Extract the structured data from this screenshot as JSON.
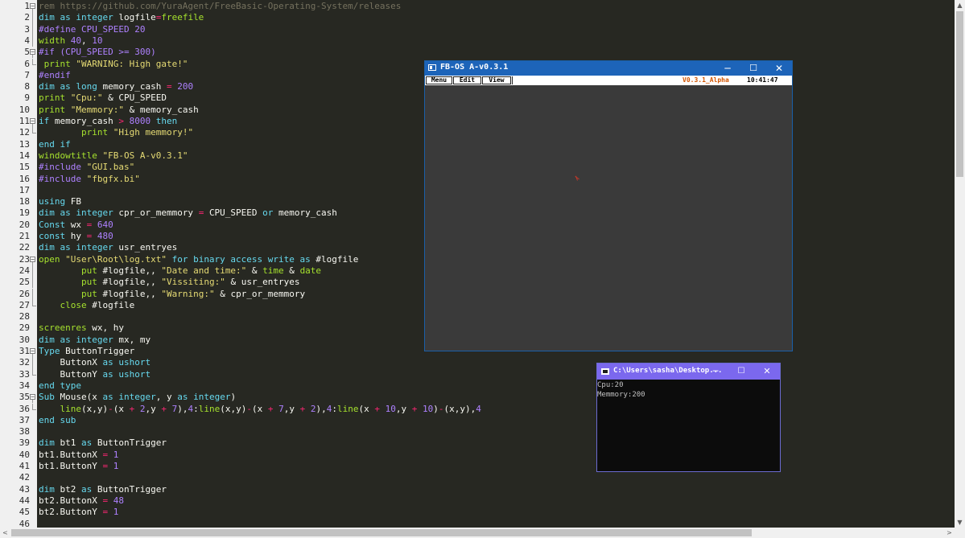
{
  "editor": {
    "lines": [
      {
        "n": "1",
        "fold": "box",
        "segs": [
          [
            "c",
            "rem https://github.com/YuraAgent/FreeBasic-Operating-System/releases"
          ]
        ]
      },
      {
        "n": "2",
        "segs": [
          [
            "k",
            "dim as integer "
          ],
          [
            "",
            "logfile"
          ],
          [
            "o",
            "="
          ],
          [
            "p",
            "freefile"
          ]
        ]
      },
      {
        "n": "3",
        "segs": [
          [
            "d",
            "#define CPU_SPEED 20"
          ]
        ]
      },
      {
        "n": "4",
        "segs": [
          [
            "p",
            "width "
          ],
          [
            "n",
            "40"
          ],
          [
            "",
            ", "
          ],
          [
            "n",
            "10"
          ]
        ]
      },
      {
        "n": "5",
        "fold": "box",
        "segs": [
          [
            "d",
            "#if (CPU_SPEED >= 300)"
          ]
        ]
      },
      {
        "n": "6",
        "fold": "end",
        "segs": [
          [
            "p",
            " print "
          ],
          [
            "s",
            "\"WARNING: High gate!\""
          ]
        ]
      },
      {
        "n": "7",
        "segs": [
          [
            "d",
            "#endif"
          ]
        ]
      },
      {
        "n": "8",
        "segs": [
          [
            "k",
            "dim as long "
          ],
          [
            "",
            "memory_cash "
          ],
          [
            "o",
            "= "
          ],
          [
            "n",
            "200"
          ]
        ]
      },
      {
        "n": "9",
        "segs": [
          [
            "p",
            "print "
          ],
          [
            "s",
            "\"Cpu:\""
          ],
          [
            "",
            " & CPU_SPEED"
          ]
        ]
      },
      {
        "n": "10",
        "segs": [
          [
            "p",
            "print "
          ],
          [
            "s",
            "\"Memmory:\""
          ],
          [
            "",
            " & memory_cash"
          ]
        ]
      },
      {
        "n": "11",
        "fold": "box",
        "segs": [
          [
            "k",
            "if "
          ],
          [
            "",
            "memory_cash "
          ],
          [
            "o",
            "> "
          ],
          [
            "n",
            "8000 "
          ],
          [
            "k",
            "then"
          ]
        ]
      },
      {
        "n": "12",
        "fold": "end",
        "segs": [
          [
            "",
            "        "
          ],
          [
            "p",
            "print "
          ],
          [
            "s",
            "\"High memmory!\""
          ]
        ]
      },
      {
        "n": "13",
        "segs": [
          [
            "k",
            "end if"
          ]
        ]
      },
      {
        "n": "14",
        "segs": [
          [
            "p",
            "windowtitle "
          ],
          [
            "s",
            "\"FB-OS A-v0.3.1\""
          ]
        ]
      },
      {
        "n": "15",
        "segs": [
          [
            "d",
            "#include "
          ],
          [
            "s",
            "\"GUI.bas\""
          ]
        ]
      },
      {
        "n": "16",
        "segs": [
          [
            "d",
            "#include "
          ],
          [
            "s",
            "\"fbgfx.bi\""
          ]
        ]
      },
      {
        "n": "17",
        "segs": []
      },
      {
        "n": "18",
        "segs": [
          [
            "k",
            "using "
          ],
          [
            "",
            "FB"
          ]
        ]
      },
      {
        "n": "19",
        "segs": [
          [
            "k",
            "dim as integer "
          ],
          [
            "",
            "cpr_or_memmory "
          ],
          [
            "o",
            "= "
          ],
          [
            "",
            "CPU_SPEED "
          ],
          [
            "k",
            "or "
          ],
          [
            "",
            "memory_cash"
          ]
        ]
      },
      {
        "n": "20",
        "segs": [
          [
            "k",
            "Const "
          ],
          [
            "",
            "wx "
          ],
          [
            "o",
            "= "
          ],
          [
            "n",
            "640"
          ]
        ]
      },
      {
        "n": "21",
        "segs": [
          [
            "k",
            "const "
          ],
          [
            "",
            "hy "
          ],
          [
            "o",
            "= "
          ],
          [
            "n",
            "480"
          ]
        ]
      },
      {
        "n": "22",
        "segs": [
          [
            "k",
            "dim as integer "
          ],
          [
            "",
            "usr_entryes"
          ]
        ]
      },
      {
        "n": "23",
        "fold": "box",
        "segs": [
          [
            "p",
            "open "
          ],
          [
            "s",
            "\"User\\Root\\log.txt\" "
          ],
          [
            "k",
            "for binary access write as "
          ],
          [
            "",
            "#logfile"
          ]
        ]
      },
      {
        "n": "24",
        "segs": [
          [
            "",
            "        "
          ],
          [
            "p",
            "put "
          ],
          [
            "",
            "#logfile,, "
          ],
          [
            "s",
            "\"Date and time:\""
          ],
          [
            "",
            " & "
          ],
          [
            "p",
            "time"
          ],
          [
            "",
            " & "
          ],
          [
            "p",
            "date"
          ]
        ]
      },
      {
        "n": "25",
        "segs": [
          [
            "",
            "        "
          ],
          [
            "p",
            "put "
          ],
          [
            "",
            "#logfile,, "
          ],
          [
            "s",
            "\"Vissiting:\""
          ],
          [
            "",
            " & usr_entryes"
          ]
        ]
      },
      {
        "n": "26",
        "segs": [
          [
            "",
            "        "
          ],
          [
            "p",
            "put "
          ],
          [
            "",
            "#logfile,, "
          ],
          [
            "s",
            "\"Warning:\""
          ],
          [
            "",
            " & cpr_or_memmory"
          ]
        ]
      },
      {
        "n": "27",
        "fold": "end",
        "segs": [
          [
            "",
            "    "
          ],
          [
            "p",
            "close "
          ],
          [
            "",
            "#logfile"
          ]
        ]
      },
      {
        "n": "28",
        "segs": []
      },
      {
        "n": "29",
        "segs": [
          [
            "p",
            "screenres "
          ],
          [
            "",
            "wx, hy"
          ]
        ]
      },
      {
        "n": "30",
        "segs": [
          [
            "k",
            "dim as integer "
          ],
          [
            "",
            "mx, my"
          ]
        ]
      },
      {
        "n": "31",
        "fold": "box",
        "segs": [
          [
            "k",
            "Type "
          ],
          [
            "",
            "ButtonTrigger"
          ]
        ]
      },
      {
        "n": "32",
        "segs": [
          [
            "",
            "    ButtonX "
          ],
          [
            "k",
            "as ushort"
          ]
        ]
      },
      {
        "n": "33",
        "fold": "end",
        "segs": [
          [
            "",
            "    ButtonY "
          ],
          [
            "k",
            "as ushort"
          ]
        ]
      },
      {
        "n": "34",
        "segs": [
          [
            "k",
            "end type"
          ]
        ]
      },
      {
        "n": "35",
        "fold": "box",
        "segs": [
          [
            "k",
            "Sub "
          ],
          [
            "",
            "Mouse(x "
          ],
          [
            "k",
            "as integer"
          ],
          [
            "",
            ", y "
          ],
          [
            "k",
            "as integer"
          ],
          [
            "",
            ")"
          ]
        ]
      },
      {
        "n": "36",
        "fold": "end",
        "segs": [
          [
            "",
            "    "
          ],
          [
            "p",
            "line"
          ],
          [
            "",
            "(x,y)"
          ],
          [
            "o",
            "-"
          ],
          [
            "",
            "(x "
          ],
          [
            "o",
            "+ "
          ],
          [
            "n",
            "2"
          ],
          [
            "",
            ",y "
          ],
          [
            "o",
            "+ "
          ],
          [
            "n",
            "7"
          ],
          [
            "",
            "),"
          ],
          [
            "n",
            "4"
          ],
          [
            "",
            ":"
          ],
          [
            "p",
            "line"
          ],
          [
            "",
            "(x,y)"
          ],
          [
            "o",
            "-"
          ],
          [
            "",
            "(x "
          ],
          [
            "o",
            "+ "
          ],
          [
            "n",
            "7"
          ],
          [
            "",
            ",y "
          ],
          [
            "o",
            "+ "
          ],
          [
            "n",
            "2"
          ],
          [
            "",
            "),"
          ],
          [
            "n",
            "4"
          ],
          [
            "",
            ":"
          ],
          [
            "p",
            "line"
          ],
          [
            "",
            "(x "
          ],
          [
            "o",
            "+ "
          ],
          [
            "n",
            "10"
          ],
          [
            "",
            ",y "
          ],
          [
            "o",
            "+ "
          ],
          [
            "n",
            "10"
          ],
          [
            "",
            ")"
          ],
          [
            "o",
            "-"
          ],
          [
            "",
            "(x,y),"
          ],
          [
            "n",
            "4"
          ]
        ]
      },
      {
        "n": "37",
        "segs": [
          [
            "k",
            "end sub"
          ]
        ]
      },
      {
        "n": "38",
        "segs": []
      },
      {
        "n": "39",
        "segs": [
          [
            "k",
            "dim "
          ],
          [
            "",
            "bt1 "
          ],
          [
            "k",
            "as "
          ],
          [
            "",
            "ButtonTrigger"
          ]
        ]
      },
      {
        "n": "40",
        "segs": [
          [
            "",
            "bt1.ButtonX "
          ],
          [
            "o",
            "= "
          ],
          [
            "n",
            "1"
          ]
        ]
      },
      {
        "n": "41",
        "segs": [
          [
            "",
            "bt1.ButtonY "
          ],
          [
            "o",
            "= "
          ],
          [
            "n",
            "1"
          ]
        ]
      },
      {
        "n": "42",
        "segs": []
      },
      {
        "n": "43",
        "segs": [
          [
            "k",
            "dim "
          ],
          [
            "",
            "bt2 "
          ],
          [
            "k",
            "as "
          ],
          [
            "",
            "ButtonTrigger"
          ]
        ]
      },
      {
        "n": "44",
        "segs": [
          [
            "",
            "bt2.ButtonX "
          ],
          [
            "o",
            "= "
          ],
          [
            "n",
            "48"
          ]
        ]
      },
      {
        "n": "45",
        "segs": [
          [
            "",
            "bt2.ButtonY "
          ],
          [
            "o",
            "= "
          ],
          [
            "n",
            "1"
          ]
        ]
      },
      {
        "n": "46",
        "segs": []
      }
    ]
  },
  "colors": {
    "editor_bg": "#272822",
    "keyword": "#66d9ef",
    "string": "#e6db74",
    "number": "#ae81ff",
    "comment": "#75715e",
    "builtin": "#a6e22e",
    "operator": "#f92672",
    "fbos_titlebar": "#1d64b9",
    "console_titlebar": "#7b68ee"
  },
  "fbos_window": {
    "title": "FB-OS A-v0.3.1",
    "menu": [
      "Menu",
      "Edit",
      "View"
    ],
    "version": "V0.3.1_Alpha",
    "clock": "10:41:47",
    "minimize": "─",
    "maximize": "☐",
    "close": "✕"
  },
  "console_window": {
    "title": "C:\\Users\\sasha\\Desktop...",
    "output": [
      "Cpu:20",
      "Memmory:200"
    ],
    "minimize": "─",
    "maximize": "☐",
    "close": "✕"
  },
  "scrollbars": {
    "up": "▲",
    "down": "▼",
    "left": "<",
    "right": ">"
  }
}
